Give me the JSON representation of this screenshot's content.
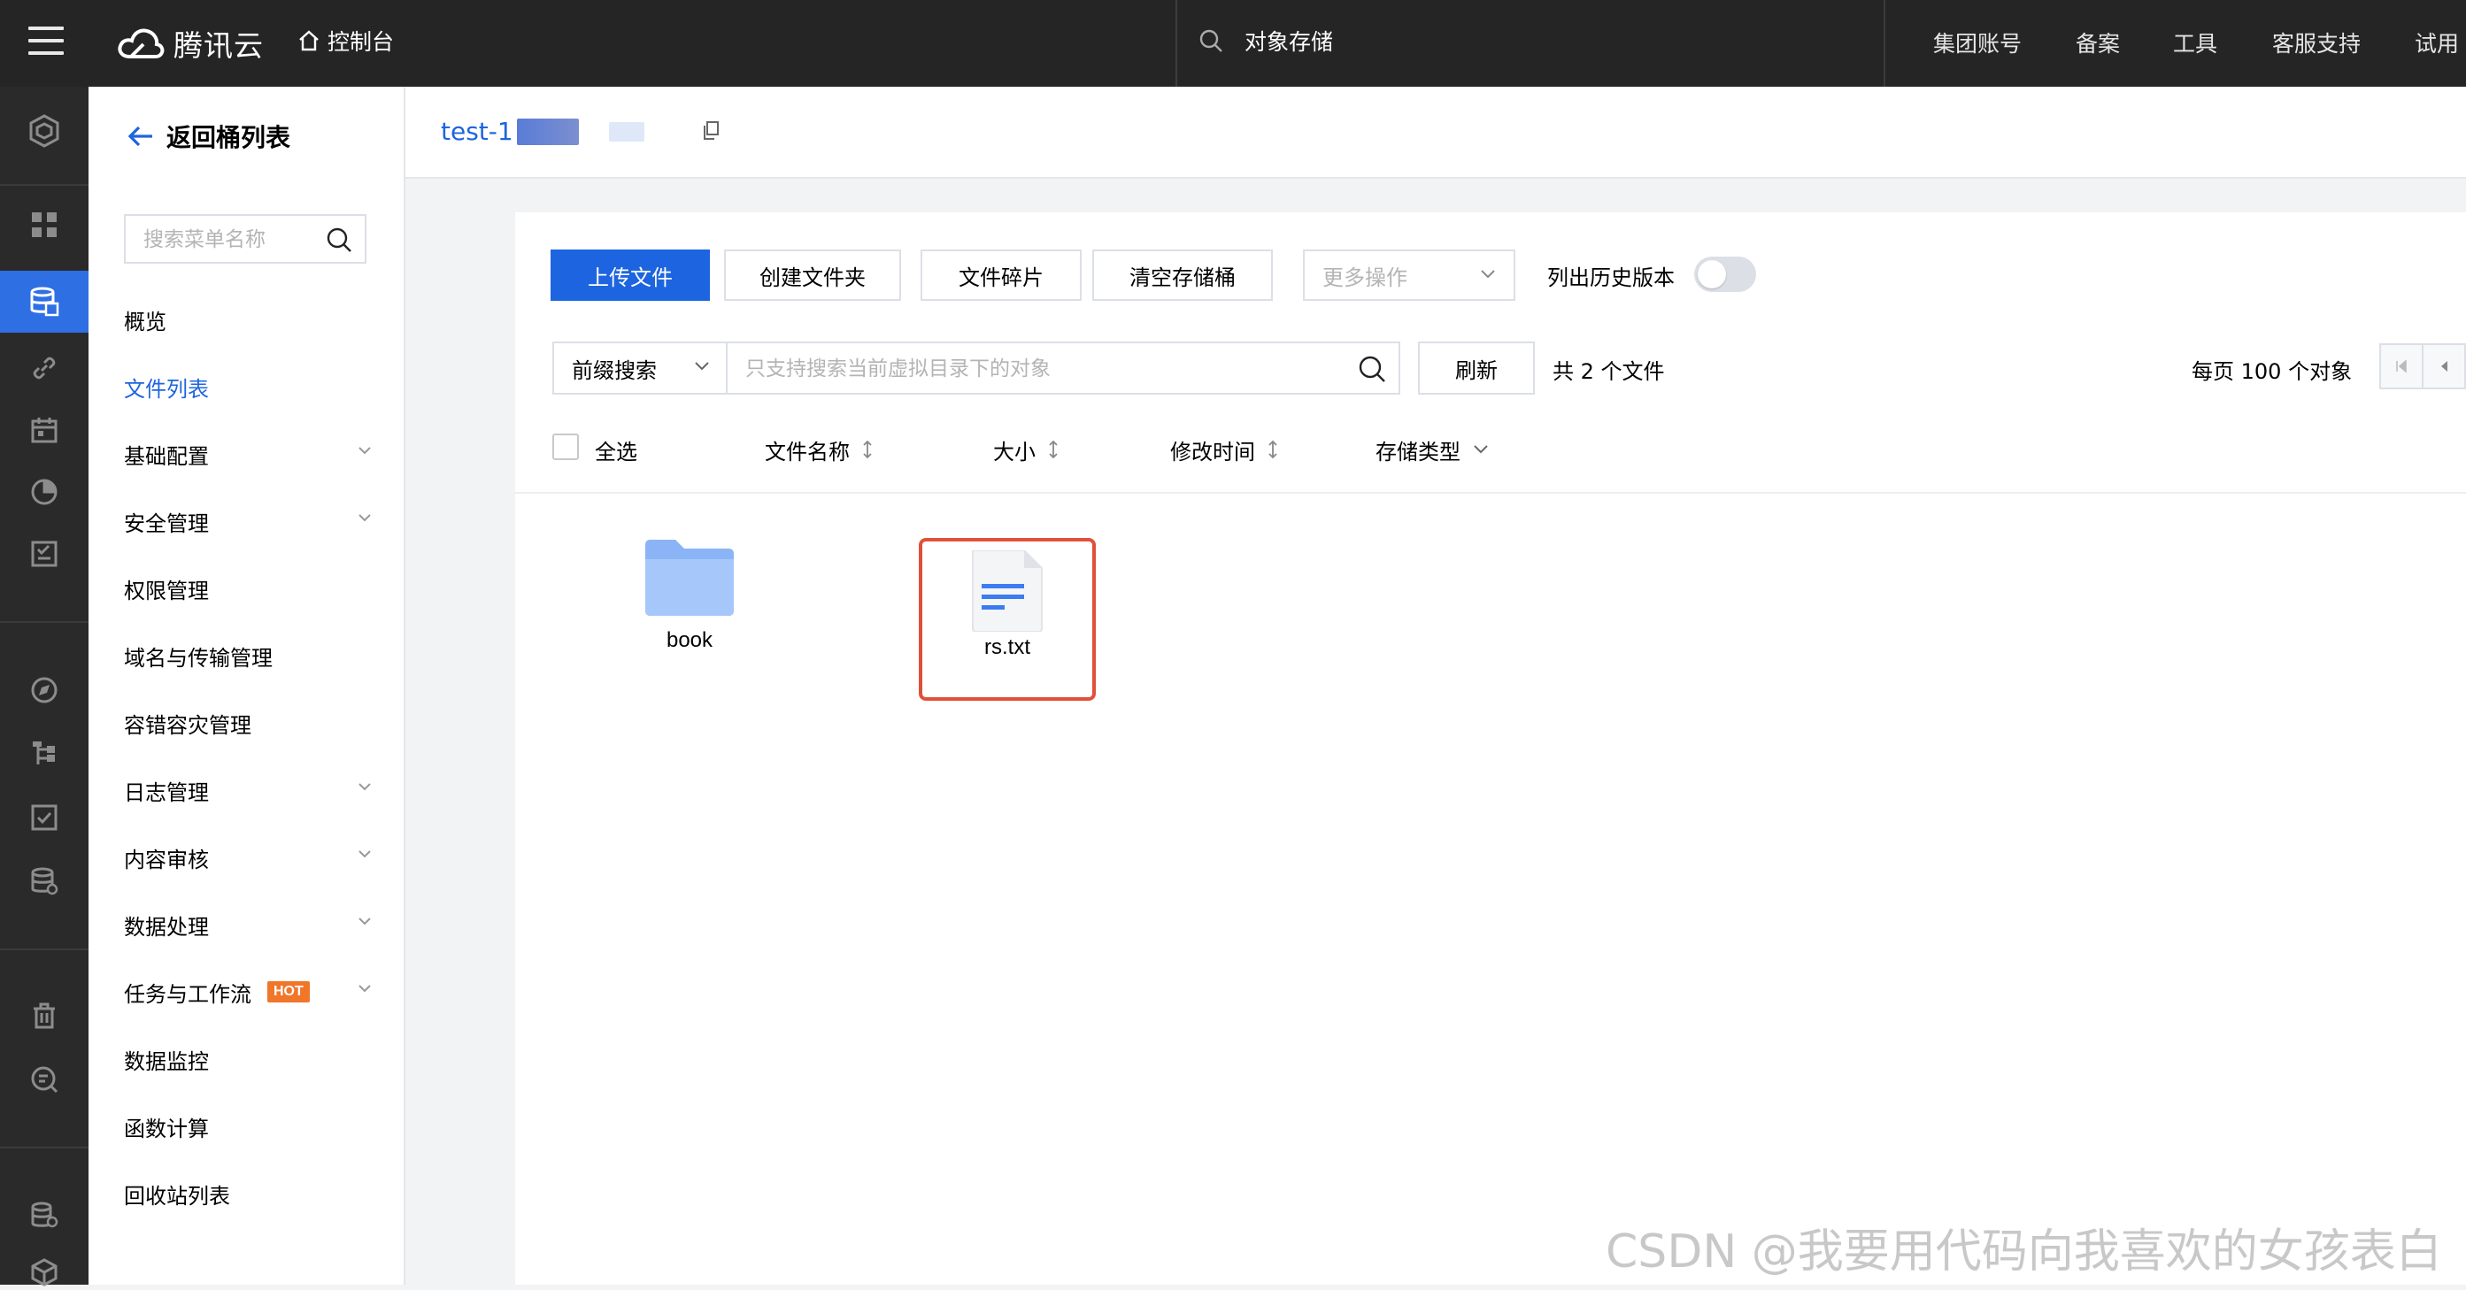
{
  "topbar": {
    "brand": "腾讯云",
    "console": "控制台",
    "search_text": "对象存储",
    "nav": [
      "集团账号",
      "备案",
      "工具",
      "客服支持",
      "试用"
    ]
  },
  "rail": {
    "icons": [
      "cube-icon",
      "grid-icon",
      "storage-icon",
      "link-icon",
      "calendar-icon",
      "pie-chart-icon",
      "checklist-icon",
      "compass-icon",
      "tree-icon",
      "check-square-icon",
      "database-icon",
      "trash-icon",
      "search-doc-icon",
      "storage-settings-icon",
      "box-icon"
    ]
  },
  "sidemenu": {
    "back_label": "返回桶列表",
    "search_placeholder": "搜索菜单名称",
    "items": [
      {
        "label": "概览",
        "expandable": false
      },
      {
        "label": "文件列表",
        "expandable": false,
        "active": true
      },
      {
        "label": "基础配置",
        "expandable": true
      },
      {
        "label": "安全管理",
        "expandable": true
      },
      {
        "label": "权限管理",
        "expandable": false
      },
      {
        "label": "域名与传输管理",
        "expandable": false
      },
      {
        "label": "容错容灾管理",
        "expandable": false
      },
      {
        "label": "日志管理",
        "expandable": true
      },
      {
        "label": "内容审核",
        "expandable": true
      },
      {
        "label": "数据处理",
        "expandable": true
      },
      {
        "label": "任务与工作流",
        "expandable": true,
        "badge": "HOT"
      },
      {
        "label": "数据监控",
        "expandable": false
      },
      {
        "label": "函数计算",
        "expandable": false
      },
      {
        "label": "回收站列表",
        "expandable": false
      }
    ]
  },
  "header": {
    "bucket_name": "test-1"
  },
  "toolbar": {
    "upload": "上传文件",
    "create_folder": "创建文件夹",
    "fragments": "文件碎片",
    "clear_bucket": "清空存储桶",
    "more_actions": "更多操作",
    "history_label": "列出历史版本",
    "history_enabled": false
  },
  "filter": {
    "prefix_option": "前缀搜索",
    "placeholder": "只支持搜索当前虚拟目录下的对象",
    "refresh": "刷新",
    "count_text": "共 2 个文件",
    "per_page_text": "每页 100 个对象"
  },
  "columns": {
    "select_all": "全选",
    "name": "文件名称",
    "size": "大小",
    "modified": "修改时间",
    "storage_class": "存储类型"
  },
  "files": [
    {
      "name": "book",
      "type": "folder",
      "selected": false
    },
    {
      "name": "rs.txt",
      "type": "text-file",
      "selected": true
    }
  ],
  "watermark": "CSDN @我要用代码向我喜欢的女孩表白",
  "colors": {
    "primary": "#1d65e0",
    "topbar": "#252525",
    "rail": "#2a2a2a",
    "selection_border": "#e0503a",
    "hot_badge": "#f0762a"
  }
}
